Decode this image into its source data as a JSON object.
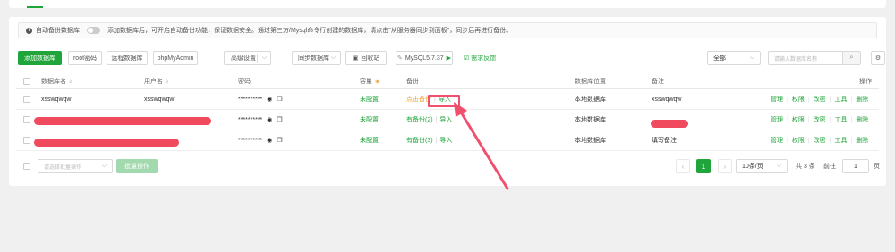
{
  "notice": {
    "auto_backup_label": "自动备份数据库",
    "text": "添加数据库后，可开启自动备份功能，保证数据安全。通过第三方/Mysql命令行创建的数据库，请点击\"从服务器同步到面板\"，同步后再进行备份。"
  },
  "toolbar": {
    "add_db": "添加数据库",
    "root_pwd": "root密码",
    "remote_db": "远程数据库",
    "phpmyadmin": "phpMyAdmin",
    "advanced": "高级设置",
    "sync_db": "同步数据库",
    "recycle": "回收站",
    "mysql_version": "MySQL5.7.37",
    "feedback": "需求反馈",
    "filter_value": "全部",
    "search_placeholder": "请输入数据库名称"
  },
  "table": {
    "headers": {
      "name": "数据库名",
      "user": "用户名",
      "password": "密码",
      "capacity": "容量",
      "backup": "备份",
      "location": "数据库位置",
      "remark": "备注",
      "ops": "操作"
    },
    "rows": [
      {
        "name": "xsswqwqw",
        "user": "xsswqwqw",
        "password": "**********",
        "capacity": "未配置",
        "backup": "点击备份",
        "import": "导入",
        "location": "本地数据库",
        "remark": "xsswqwqw"
      },
      {
        "name": "",
        "user": "",
        "password": "**********",
        "capacity": "未配置",
        "backup": "有备份(2)",
        "import": "导入",
        "location": "本地数据库",
        "remark": ""
      },
      {
        "name": "",
        "user": "",
        "password": "**********",
        "capacity": "未配置",
        "backup": "有备份(3)",
        "import": "导入",
        "location": "本地数据库",
        "remark": "填写备注"
      }
    ],
    "op_labels": [
      "管理",
      "权限",
      "改密",
      "工具",
      "删除"
    ]
  },
  "footer": {
    "batch_placeholder": "请选择批量操作",
    "batch_button": "批量操作",
    "current_page": "1",
    "page_size": "10条/页",
    "total": "共 3 条",
    "goto_label": "前往",
    "goto_value": "1",
    "page_suffix": "页"
  },
  "colors": {
    "accent": "#20a53a",
    "highlight": "#f0506e",
    "redaction": "#f04a5e",
    "warning": "#f0a030"
  }
}
